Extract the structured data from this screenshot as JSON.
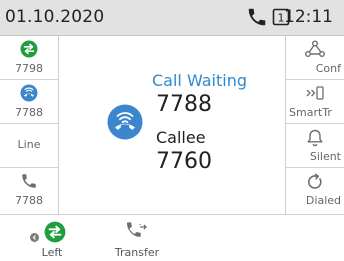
{
  "status": {
    "date": "01.10.2020",
    "time": "12:11",
    "line_number": "1"
  },
  "left_keys": [
    {
      "label": "7798",
      "icon": "call-swap-icon"
    },
    {
      "label": "7788",
      "icon": "call-waiting-icon"
    },
    {
      "label": "Line",
      "icon": ""
    },
    {
      "label": "7788",
      "icon": "phone-icon"
    }
  ],
  "right_keys": [
    {
      "label": "Conf",
      "icon": "conference-icon"
    },
    {
      "label": "SmartTr",
      "icon": "smart-transfer-icon"
    },
    {
      "label": "Silent",
      "icon": "bell-icon"
    },
    {
      "label": "Dialed",
      "icon": "redial-icon"
    }
  ],
  "call": {
    "title": "Call Waiting",
    "number": "7788",
    "callee_label": "Callee",
    "callee_number": "7760"
  },
  "bottom_keys": [
    {
      "label": "Left",
      "icon": "call-swap-icon"
    },
    {
      "label": "Transfer",
      "icon": "transfer-icon"
    }
  ],
  "colors": {
    "green": "#1e9e3e",
    "blue": "#3b86cc",
    "gray_icon": "#6e6e6e"
  }
}
